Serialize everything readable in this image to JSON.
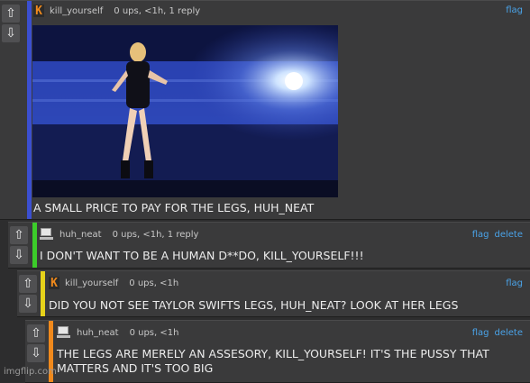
{
  "vote": {
    "up": "⇧",
    "down": "⇩"
  },
  "colors": {
    "accent_blue": "#3b4fd0",
    "accent_green": "#3ccc2a",
    "accent_yellow": "#e6d21a",
    "accent_orange": "#f0891c",
    "link": "#4aa3e8"
  },
  "comments": [
    {
      "user": "kill_yourself",
      "stats": "0 ups, <1h, 1 reply",
      "actions": [
        "flag"
      ],
      "text": "A SMALL PRICE TO PAY FOR THE LEGS, HUH_NEAT",
      "avatar": "k-logo-icon"
    },
    {
      "user": "huh_neat",
      "stats": "0 ups, <1h, 1 reply",
      "actions": [
        "flag",
        "delete"
      ],
      "text": "I DON'T WANT TO BE A HUMAN D**DO, KILL_YOURSELF!!!",
      "avatar": "computer-icon"
    },
    {
      "user": "kill_yourself",
      "stats": "0 ups, <1h",
      "actions": [
        "flag"
      ],
      "text": "DID YOU NOT SEE TAYLOR SWIFTS LEGS, HUH_NEAT? LOOK AT HER LEGS",
      "avatar": "k-logo-icon"
    },
    {
      "user": "huh_neat",
      "stats": "0 ups, <1h",
      "actions": [
        "flag",
        "delete"
      ],
      "text": "THE LEGS ARE MERELY AN ASSESORY, KILL_YOURSELF! IT'S THE PUSSY THAT MATTERS AND IT'S TOO BIG",
      "avatar": "computer-icon"
    }
  ],
  "watermark": "imgflip.com"
}
